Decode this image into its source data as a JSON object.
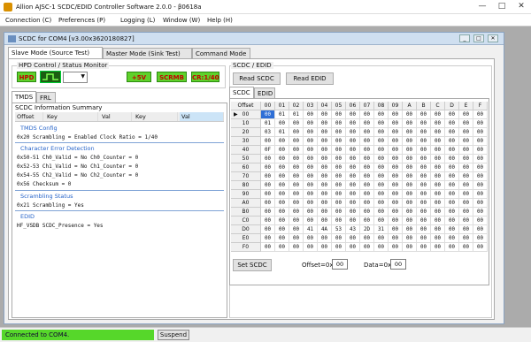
{
  "window": {
    "title": "Allion AJSC-1 SCDC/EDID Controller Software 2.0.0 - β0618a"
  },
  "menu": [
    "Connection (C)",
    "Preferences (P)",
    "Logging (L)",
    "Window (W)",
    "Help (H)"
  ],
  "child": {
    "title": "SCDC for COM4 [v3.00x3620180827]"
  },
  "main_tabs": [
    "Slave Mode (Source Test)",
    "Master Mode (Sink Test)",
    "Command Mode"
  ],
  "hpd": {
    "group_title": "HPD Control / Status Monitor",
    "hpd_btn": "HPD",
    "plus5v": "+5V",
    "scrmb": "SCRMB",
    "cr": "CR:1/40"
  },
  "left_tabs": [
    "TMDS",
    "FRL"
  ],
  "info": {
    "title": "SCDC Information Summary",
    "headers": [
      "Offset",
      "Key",
      "Val",
      "Key",
      "Val"
    ],
    "sections": {
      "tmds": "TMDS Config",
      "err": "Character Error Detection",
      "scr": "Scrambling Status",
      "edid": "EDID"
    },
    "rows": {
      "tmds": [
        "0x20    Scrambling     =    Enabled    Clock Ratio =  1/40"
      ],
      "err": [
        "0x50-51   Ch0_Valid    =    No          Ch0_Counter  =   0",
        "0x52-53   Ch1_Valid    =    No          Ch1_Counter  =   0",
        "0x54-55   Ch2_Valid    =    No          Ch2_Counter  =   0",
        "0x56      Checksum     =    0"
      ],
      "scr": [
        "0x21      Scrambling     =    Yes"
      ],
      "edid": [
        "HF_VSDB   SCDC_Presence  =    Yes"
      ]
    }
  },
  "right": {
    "group_title": "SCDC / EDID",
    "read_scdc": "Read SCDC",
    "read_edid": "Read EDID",
    "tabs": [
      "SCDC",
      "EDID"
    ],
    "grid_header": [
      "Offset",
      "00",
      "01",
      "02",
      "03",
      "04",
      "05",
      "06",
      "07",
      "08",
      "09",
      "A",
      "B",
      "C",
      "D",
      "E",
      "F"
    ],
    "row_labels": [
      "00",
      "10",
      "20",
      "30",
      "40",
      "50",
      "60",
      "70",
      "80",
      "90",
      "A0",
      "B0",
      "C0",
      "D0",
      "E0",
      "F0"
    ],
    "rows": [
      [
        "00",
        "01",
        "01",
        "00",
        "00",
        "00",
        "00",
        "00",
        "00",
        "00",
        "00",
        "00",
        "00",
        "00",
        "00",
        "00"
      ],
      [
        "01",
        "00",
        "00",
        "00",
        "00",
        "00",
        "00",
        "00",
        "00",
        "00",
        "00",
        "00",
        "00",
        "00",
        "00",
        "00"
      ],
      [
        "03",
        "01",
        "00",
        "00",
        "00",
        "00",
        "00",
        "00",
        "00",
        "00",
        "00",
        "00",
        "00",
        "00",
        "00",
        "00"
      ],
      [
        "00",
        "00",
        "00",
        "00",
        "00",
        "00",
        "00",
        "00",
        "00",
        "00",
        "00",
        "00",
        "00",
        "00",
        "00",
        "00"
      ],
      [
        "0F",
        "00",
        "00",
        "00",
        "00",
        "00",
        "00",
        "00",
        "00",
        "00",
        "00",
        "00",
        "00",
        "00",
        "00",
        "00"
      ],
      [
        "00",
        "00",
        "00",
        "00",
        "00",
        "00",
        "00",
        "00",
        "00",
        "00",
        "00",
        "00",
        "00",
        "00",
        "00",
        "00"
      ],
      [
        "00",
        "00",
        "00",
        "00",
        "00",
        "00",
        "00",
        "00",
        "00",
        "00",
        "00",
        "00",
        "00",
        "00",
        "00",
        "00"
      ],
      [
        "00",
        "00",
        "00",
        "00",
        "00",
        "00",
        "00",
        "00",
        "00",
        "00",
        "00",
        "00",
        "00",
        "00",
        "00",
        "00"
      ],
      [
        "00",
        "00",
        "00",
        "00",
        "00",
        "00",
        "00",
        "00",
        "00",
        "00",
        "00",
        "00",
        "00",
        "00",
        "00",
        "00"
      ],
      [
        "00",
        "00",
        "00",
        "00",
        "00",
        "00",
        "00",
        "00",
        "00",
        "00",
        "00",
        "00",
        "00",
        "00",
        "00",
        "00"
      ],
      [
        "00",
        "00",
        "00",
        "00",
        "00",
        "00",
        "00",
        "00",
        "00",
        "00",
        "00",
        "00",
        "00",
        "00",
        "00",
        "00"
      ],
      [
        "00",
        "00",
        "00",
        "00",
        "00",
        "00",
        "00",
        "00",
        "00",
        "00",
        "00",
        "00",
        "00",
        "00",
        "00",
        "00"
      ],
      [
        "00",
        "00",
        "00",
        "00",
        "00",
        "00",
        "00",
        "00",
        "00",
        "00",
        "00",
        "00",
        "00",
        "00",
        "00",
        "00"
      ],
      [
        "00",
        "00",
        "00",
        "41",
        "4A",
        "53",
        "43",
        "2D",
        "31",
        "00",
        "00",
        "00",
        "00",
        "00",
        "00",
        "00"
      ],
      [
        "00",
        "00",
        "00",
        "00",
        "00",
        "00",
        "00",
        "00",
        "00",
        "00",
        "00",
        "00",
        "00",
        "00",
        "00",
        "00"
      ],
      [
        "00",
        "00",
        "00",
        "00",
        "00",
        "00",
        "00",
        "00",
        "00",
        "00",
        "00",
        "00",
        "00",
        "00",
        "00",
        "00"
      ]
    ],
    "set_scdc": "Set SCDC",
    "offset_label": "Offset=0x",
    "offset_value": "00",
    "data_label": "Data=0x",
    "data_value": "00"
  },
  "status": {
    "connection": "Connected to COM4.",
    "suspend": "Suspend"
  },
  "colors": {
    "green": "#5fd12b",
    "selected": "#2f6fd6"
  }
}
